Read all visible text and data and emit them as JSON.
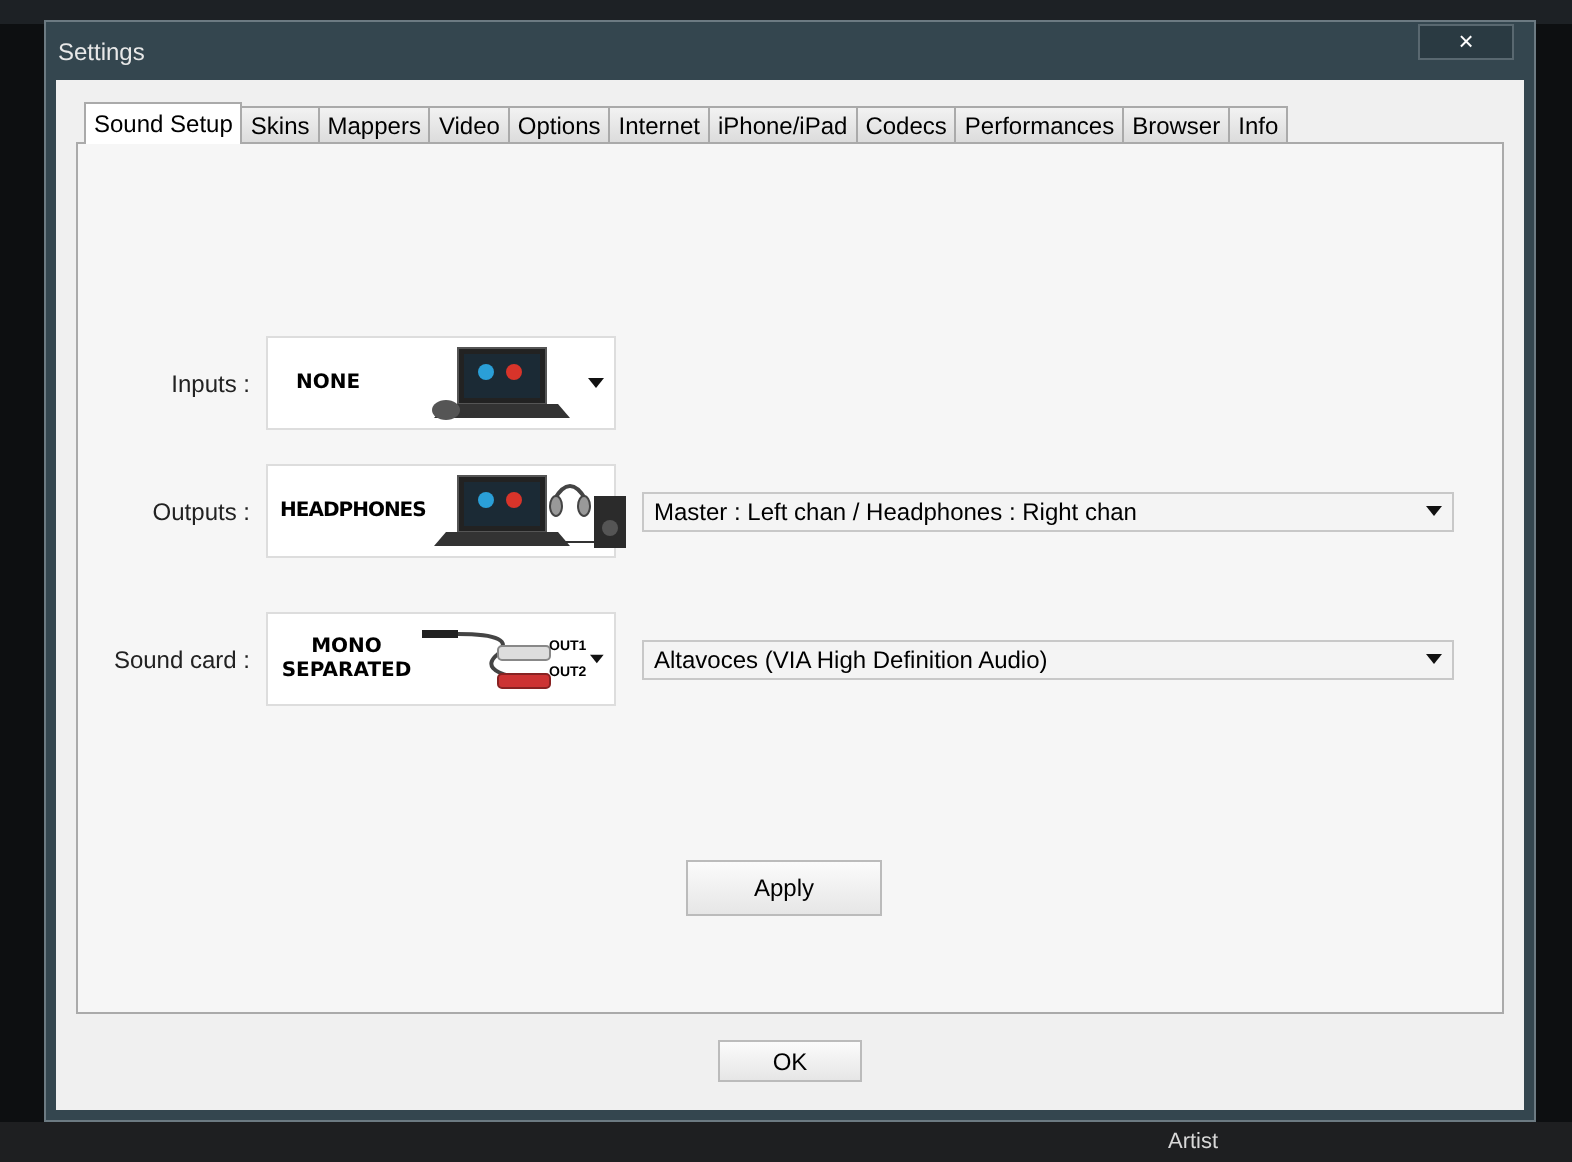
{
  "window": {
    "title": "Settings",
    "close": "×"
  },
  "tabs": [
    {
      "label": "Sound Setup",
      "selected": true
    },
    {
      "label": "Skins",
      "selected": false
    },
    {
      "label": "Mappers",
      "selected": false
    },
    {
      "label": "Video",
      "selected": false
    },
    {
      "label": "Options",
      "selected": false
    },
    {
      "label": "Internet",
      "selected": false
    },
    {
      "label": "iPhone/iPad",
      "selected": false
    },
    {
      "label": "Codecs",
      "selected": false
    },
    {
      "label": "Performances",
      "selected": false
    },
    {
      "label": "Browser",
      "selected": false
    },
    {
      "label": "Info",
      "selected": false
    }
  ],
  "rows": [
    {
      "label": "Inputs :",
      "picker": {
        "kind": "mouse",
        "caption": "NONE"
      }
    },
    {
      "label": "Outputs :",
      "picker": {
        "kind": "headphones",
        "caption": "HEADPHONES"
      },
      "select": "Master : Left chan / Headphones : Right chan"
    },
    {
      "label": "Sound card :",
      "picker": {
        "kind": "cable",
        "caption": "MONO SEPARATED",
        "plugs": [
          "OUT1",
          "OUT2"
        ]
      },
      "select": "Altavoces (VIA High Definition Audio)"
    }
  ],
  "apply_button": "Apply",
  "ok_button": "OK",
  "background": {
    "column_label": "Artist"
  }
}
